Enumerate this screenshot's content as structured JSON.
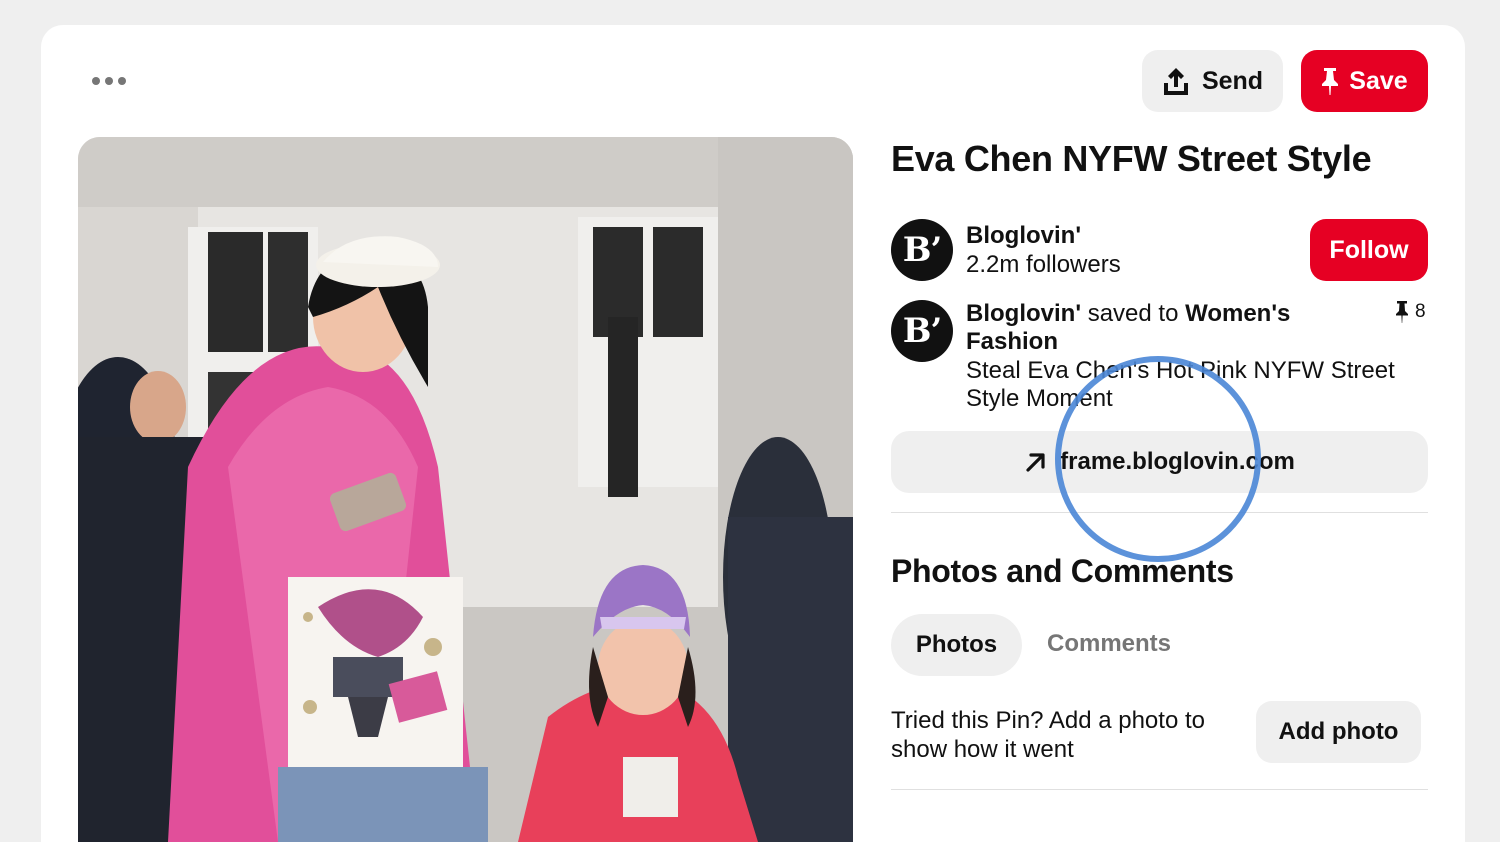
{
  "header": {
    "more_icon": "more-horizontal-icon",
    "send_label": "Send",
    "send_icon": "share-upload-icon",
    "save_label": "Save",
    "save_icon": "pin-icon",
    "save_color": "#e60023"
  },
  "pin": {
    "title": "Eva Chen NYFW Street Style",
    "image_alt": "pin-photo",
    "creator": {
      "avatar_text": "B’",
      "name": "Bloglovin'",
      "followers": "2.2m followers",
      "follow_label": "Follow"
    },
    "saved_by": {
      "avatar_text": "B’",
      "user": "Bloglovin'",
      "saved_to_text": " saved to ",
      "board": "Women's Fashion",
      "description": "Steal Eva Chen's Hot Pink NYFW Street Style Moment",
      "pin_count": "8",
      "pin_icon": "pin-icon"
    },
    "link": {
      "icon": "external-arrow-icon",
      "domain": "frame.bloglovin.com"
    }
  },
  "photos_and_comments": {
    "title": "Photos and Comments",
    "tabs": [
      {
        "label": "Photos",
        "active": true
      },
      {
        "label": "Comments",
        "active": false
      }
    ],
    "prompt": "Tried this Pin? Add a photo to show how it went",
    "add_photo_label": "Add photo"
  },
  "colors": {
    "accent": "#e60023",
    "highlight_ring": "#4a86d6",
    "secondary_bg": "#efefef"
  }
}
